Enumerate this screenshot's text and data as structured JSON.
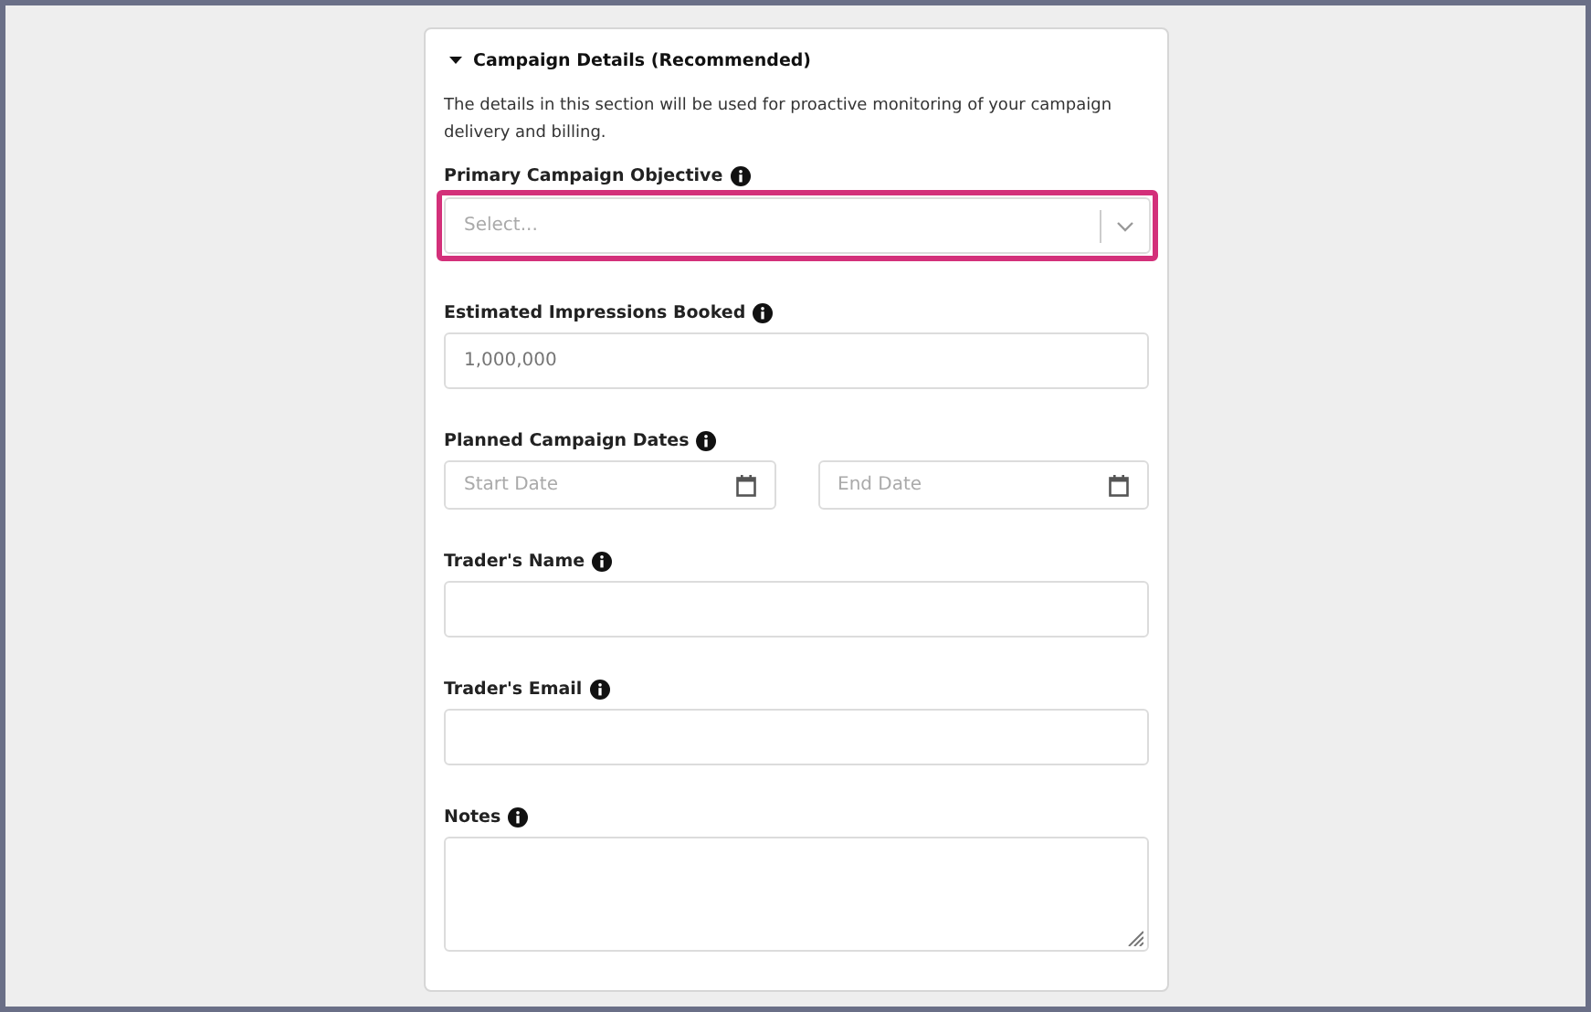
{
  "section": {
    "title": "Campaign Details (Recommended)",
    "expanded": true,
    "description": "The details in this section will be used for proactive monitoring of your campaign delivery and billing.",
    "fields": [
      {
        "kind": "select",
        "label": "Primary Campaign Objective",
        "placeholder": "Select...",
        "highlighted": true
      },
      {
        "kind": "text",
        "label": "Estimated Impressions Booked",
        "placeholder": "1,000,000",
        "highlighted": false
      },
      {
        "kind": "daterange",
        "label": "Planned Campaign Dates",
        "start_placeholder": "Start Date",
        "end_placeholder": "End Date",
        "highlighted": false
      },
      {
        "kind": "text",
        "label": "Trader's Name",
        "highlighted": false
      },
      {
        "kind": "text",
        "label": "Trader's Email",
        "highlighted": false
      },
      {
        "kind": "textarea",
        "label": "Notes",
        "highlighted": false
      }
    ]
  }
}
